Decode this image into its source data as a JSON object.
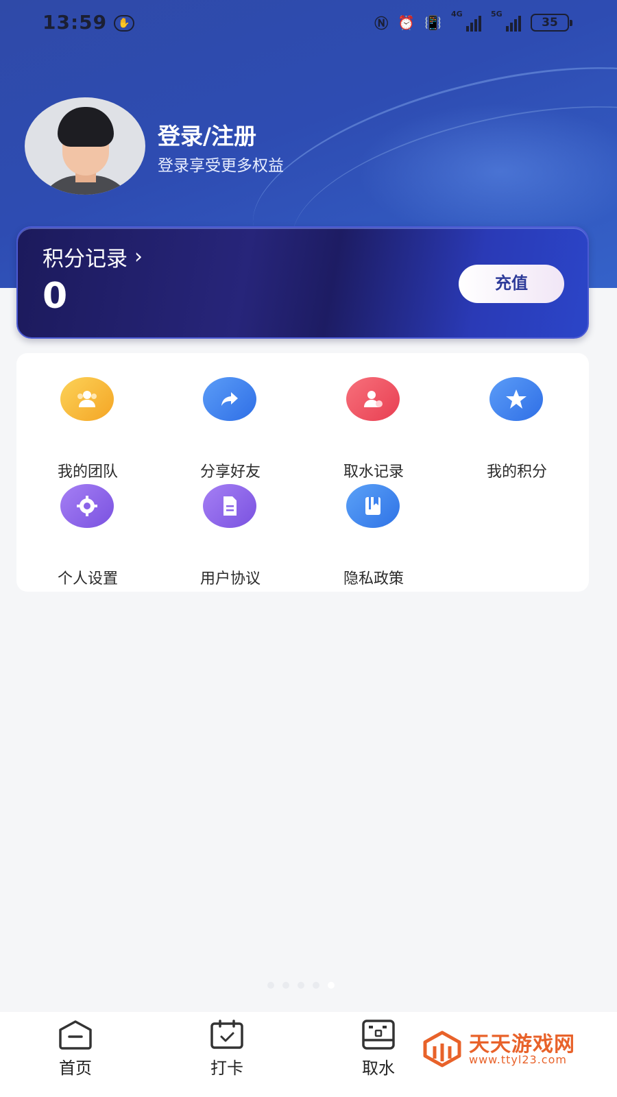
{
  "status_bar": {
    "time": "13:59",
    "signal1": "4G",
    "signal2": "5G",
    "battery": "35"
  },
  "profile": {
    "title": "登录/注册",
    "subtitle": "登录享受更多权益"
  },
  "points_card": {
    "title": "积分记录",
    "value": "0",
    "recharge_label": "充值"
  },
  "menu": {
    "items": [
      {
        "label": "我的团队",
        "icon": "team-icon",
        "color": "#f7b52f"
      },
      {
        "label": "分享好友",
        "icon": "share-icon",
        "color": "#3f7ff0"
      },
      {
        "label": "取水记录",
        "icon": "record-icon",
        "color": "#f0505f"
      },
      {
        "label": "我的积分",
        "icon": "star-icon",
        "color": "#3f7ff0"
      },
      {
        "label": "个人设置",
        "icon": "gear-icon",
        "color": "#8a63e8"
      },
      {
        "label": "用户协议",
        "icon": "document-icon",
        "color": "#8a63e8"
      },
      {
        "label": "隐私政策",
        "icon": "book-icon",
        "color": "#3f84f0"
      }
    ]
  },
  "bottom_nav": {
    "items": [
      {
        "label": "首页",
        "icon": "home-icon"
      },
      {
        "label": "打卡",
        "icon": "calendar-check-icon"
      },
      {
        "label": "取水",
        "icon": "water-machine-icon"
      }
    ]
  },
  "watermark": {
    "title": "天天游戏网",
    "url": "www.ttyl23.com"
  },
  "colors": {
    "header_blue": "#2f4aa8",
    "card_navy": "#1c1a5c",
    "button_text": "#2e3b99",
    "watermark_orange": "#e8622a"
  }
}
